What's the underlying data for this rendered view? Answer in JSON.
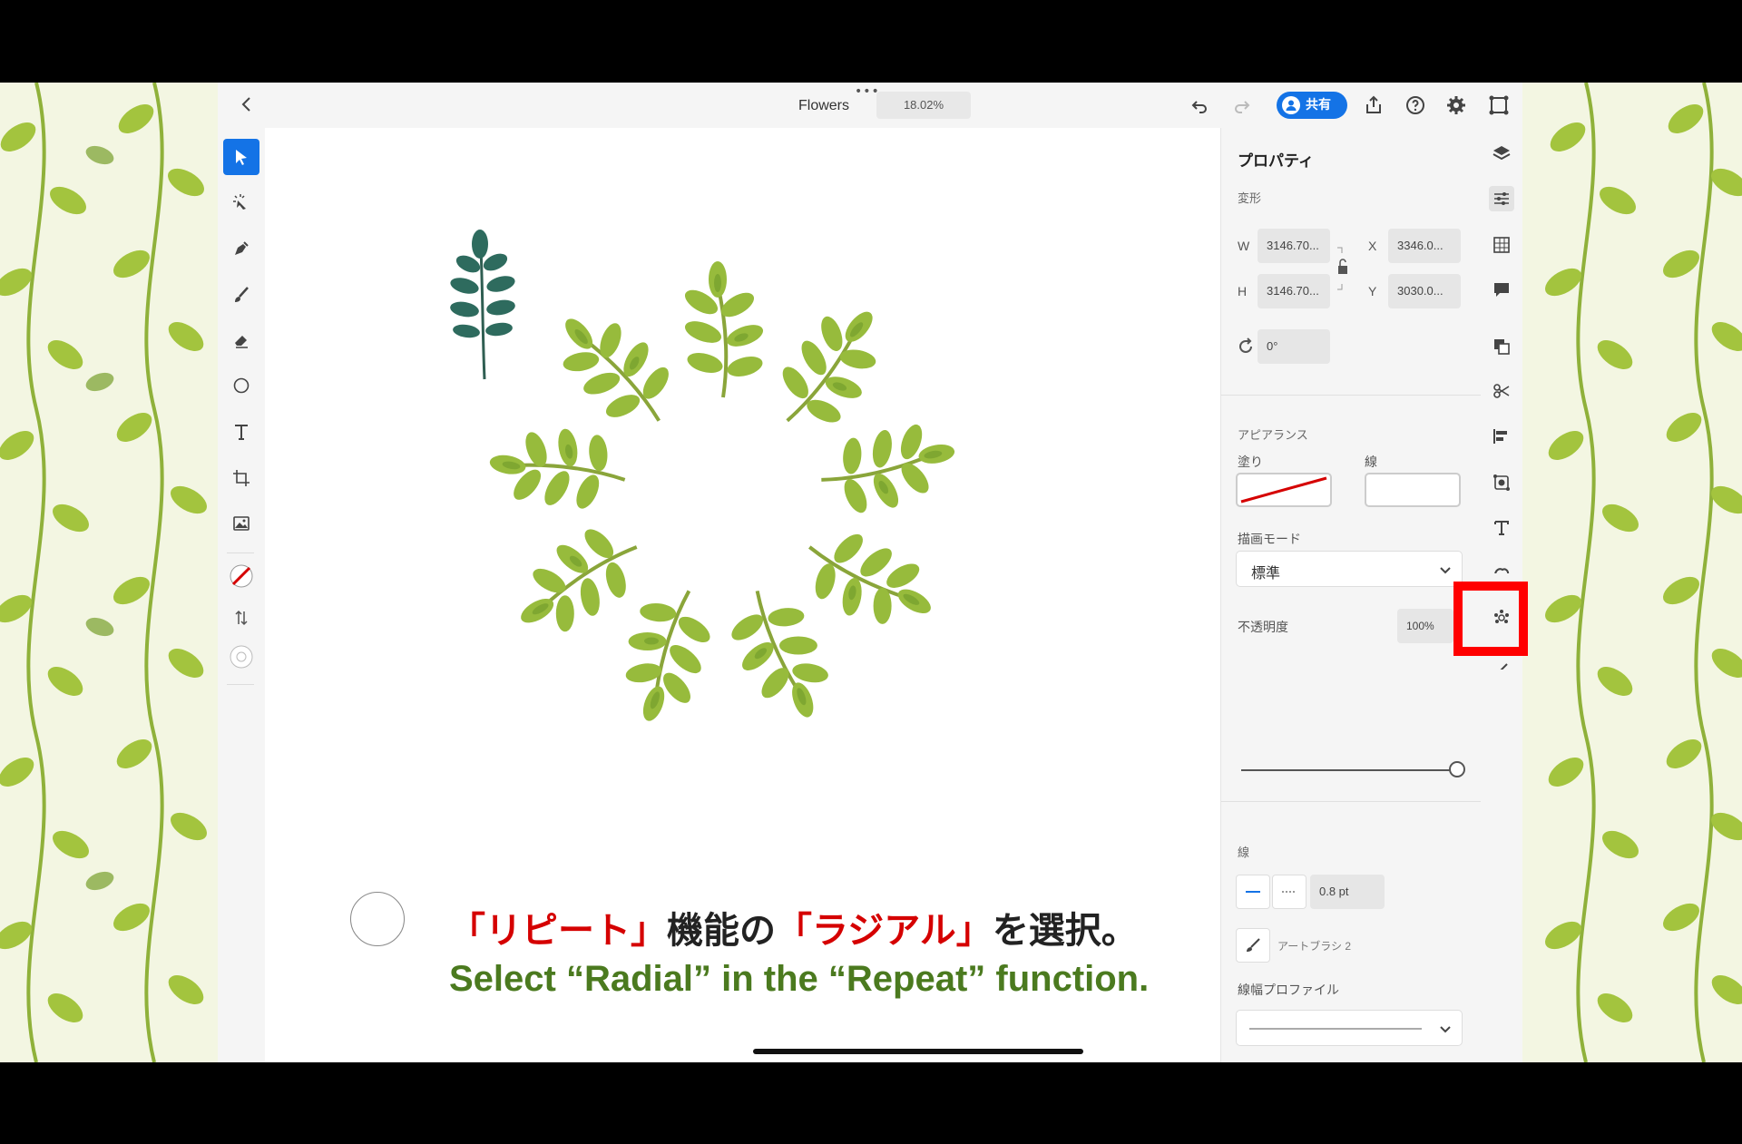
{
  "topbar": {
    "title": "Flowers",
    "zoom": "18.02%",
    "share_label": "共有",
    "icons": [
      "chevron-left-icon",
      "undo-icon",
      "redo-icon",
      "export-icon",
      "help-icon",
      "gear-icon",
      "cloud-sync-icon"
    ]
  },
  "toolbar": {
    "tools": [
      "selection",
      "magic-select",
      "pen",
      "brush",
      "eraser",
      "shape",
      "text",
      "crop",
      "image"
    ],
    "active": "selection"
  },
  "caption": {
    "line1_a": "「リピート」",
    "line1_b": "機能の",
    "line1_c": "「ラジアル」",
    "line1_d": "を選択。",
    "line2": "Select “Radial” in the “Repeat” function."
  },
  "properties": {
    "title": "プロパティ",
    "transform": {
      "label": "変形",
      "w_label": "W",
      "w_value": "3146.70...",
      "h_label": "H",
      "h_value": "3146.70...",
      "x_label": "X",
      "x_value": "3346.0...",
      "y_label": "Y",
      "y_value": "3030.0...",
      "rotation": "0°"
    },
    "appearance": {
      "label": "アピアランス",
      "fill_label": "塗り",
      "stroke_label": "線",
      "blend_label": "描画モード",
      "blend_value": "標準",
      "opacity_label": "不透明度",
      "opacity_value": "100%",
      "opacity_level": 1.0
    },
    "stroke": {
      "label": "線",
      "weight": "0.8 pt",
      "brush_name": "アートブラシ 2",
      "profile_label": "線幅プロファイル"
    }
  },
  "colors": {
    "accent": "#1473e6",
    "highlight": "#ff0000",
    "caption_red": "#d50000",
    "caption_green": "#4b7a1f"
  }
}
